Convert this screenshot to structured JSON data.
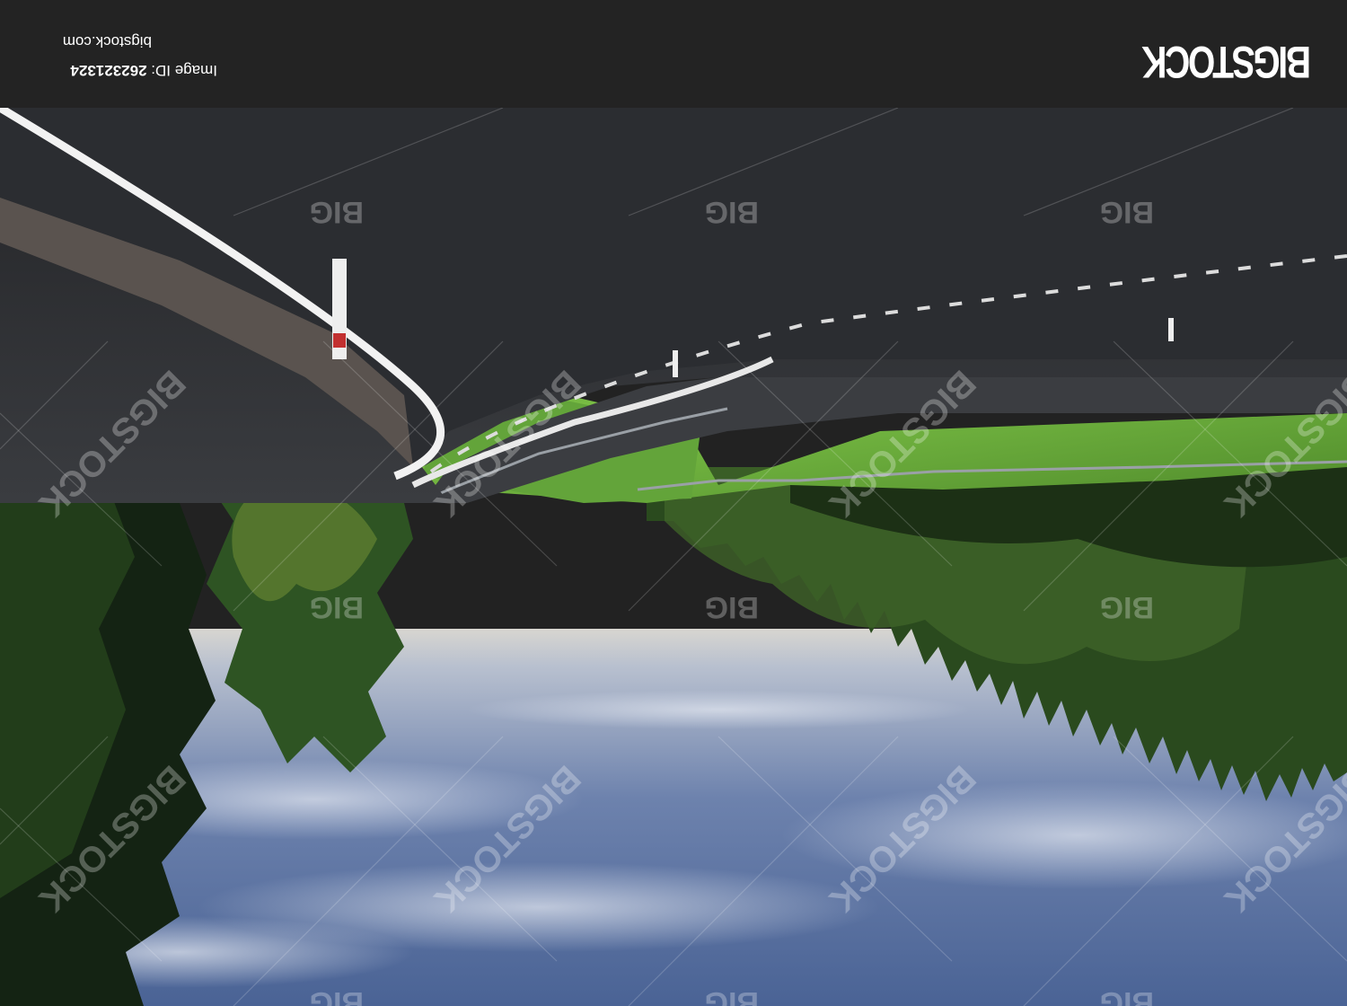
{
  "stock_photo": {
    "orientation": "rotated 180 degrees",
    "brand": "BIGSTOCK",
    "image_id_label": "Image ID:",
    "image_id": "262321324",
    "site_url": "bigstock.com",
    "watermark_large": "BIGSTOCK",
    "watermark_small": "BIG"
  },
  "colors": {
    "footer_background": "#232323",
    "footer_text": "#ffffff",
    "sky": "#5f78a5",
    "road": "#2d2f33",
    "grass": "#6fb33c",
    "forest": "#24371a"
  }
}
